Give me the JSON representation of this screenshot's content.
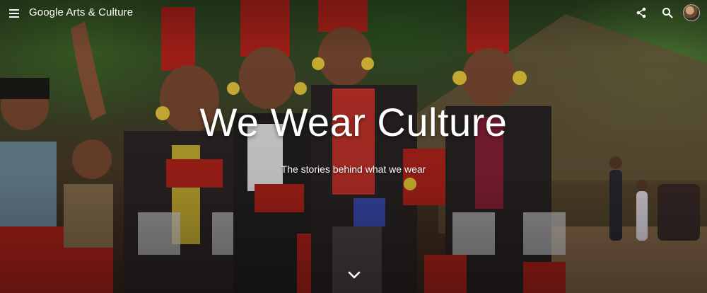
{
  "header": {
    "logo_text": "Google Arts & Culture",
    "icons": [
      "menu-icon",
      "share-icon",
      "search-icon",
      "avatar"
    ]
  },
  "hero": {
    "title": "We Wear Culture",
    "subtitle": "The stories behind what we wear",
    "scroll_icon": "chevron-down-icon"
  },
  "colors": {
    "text": "#ffffff",
    "headdress_red": "#b5231b",
    "foliage_green": "#3e6826",
    "skin_brown": "#7a4a31"
  }
}
